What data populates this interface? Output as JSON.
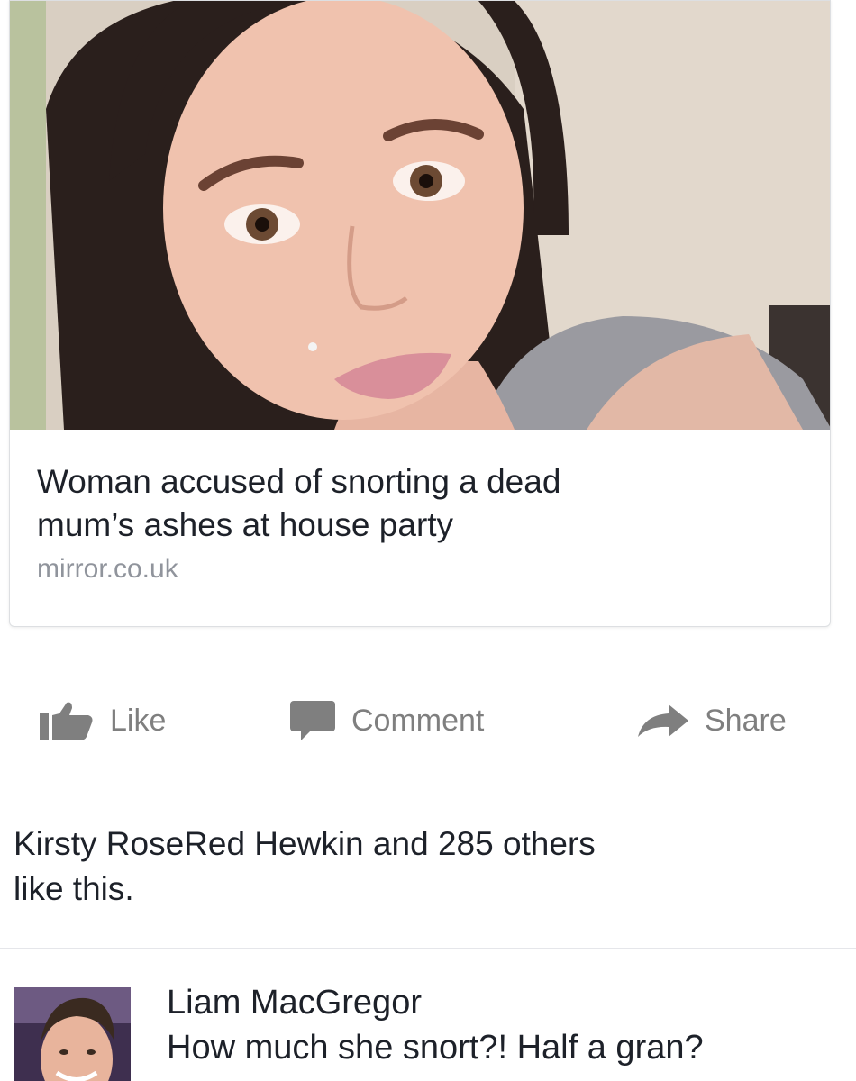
{
  "link_preview": {
    "headline_line1": "Woman accused of snorting a dead",
    "headline_line2": "mum’s ashes at house party",
    "domain": "mirror.co.uk"
  },
  "actions": {
    "like": "Like",
    "comment": "Comment",
    "share": "Share"
  },
  "likes_summary": {
    "name": "Kirsty RoseRed Hewkin",
    "and": " and ",
    "others": "285 others",
    "line2": "like this."
  },
  "comment": {
    "author": "Liam MacGregor",
    "text": "How much she snort?! Half a gran?"
  },
  "colors": {
    "text": "#1d2129",
    "muted": "#90949c",
    "action_gray": "#7f7f7f"
  },
  "icons": [
    "thumbs-up-icon",
    "comment-bubble-icon",
    "share-arrow-icon"
  ]
}
